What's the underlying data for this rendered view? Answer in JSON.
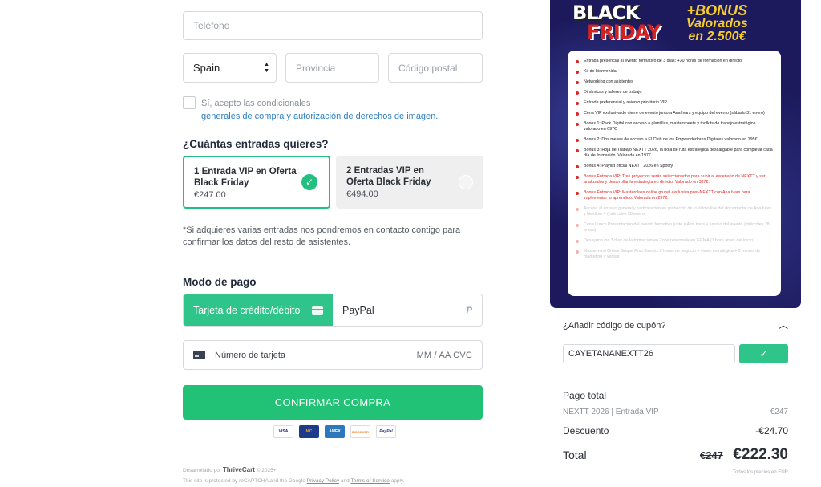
{
  "form": {
    "phone_placeholder": "Teléfono",
    "country_value": "Spain",
    "province_placeholder": "Provincia",
    "postal_placeholder": "Código postal",
    "terms_text": "Sí, acepto las condicionales",
    "terms_link": "generales de compra y autorización de derechos de imagen."
  },
  "tickets": {
    "heading": "¿Cuántas entradas quieres?",
    "options": [
      {
        "name": "1 Entrada VIP en Oferta Black Friday",
        "price": "€247.00",
        "selected": true
      },
      {
        "name": "2 Entradas VIP en Oferta Black Friday",
        "price": "€494.00",
        "selected": false
      }
    ],
    "note": "*Si adquieres varias entradas nos pondremos en contacto contigo para confirmar los datos del resto de asistentes."
  },
  "payment": {
    "heading": "Modo de pago",
    "tab_card": "Tarjeta de crédito/débito",
    "tab_paypal": "PayPal",
    "card_placeholder": "Número de tarjeta",
    "card_right": "MM / AA  CVC",
    "confirm_label": "CONFIRMAR COMPRA",
    "logos": [
      "VISA",
      "MC",
      "AMEX",
      "DISCOVER",
      "PayPal"
    ]
  },
  "footer": {
    "line1_prefix": "Desarrollado por",
    "line1_brand": "ThriveCart",
    "line1_suffix": "© 2025+",
    "line2_prefix": "This site is protected by reCAPTCHA and the Google",
    "privacy": "Privacy Policy",
    "and": "and",
    "terms": "Terms of Service",
    "apply": "apply."
  },
  "promo": {
    "title_line1": "BLACK",
    "title_line2": "FRIDAY",
    "bonus_line1": "+BONUS",
    "bonus_line2": "Valorados",
    "bonus_line3": "en 2.500€",
    "items": [
      "Entrada presencial al evento formativo de 3 días: +30 horas de formación en directo",
      "Kit de bienvenida",
      "Networking con asistentes",
      "Dinámicas y talleres de trabajo",
      "Entrada preferencial y asiento prioritario VIP",
      "Cena VIP exclusiva de cierre de evento junto a Ana Ivars y equipo del evento (sábado 31 enero)",
      "Bonus 1: Pack Digital con acceso a plantillas, mastersheets y toolkits de trabajo estratégico valorado en 697€.",
      "Bonus 2: Dos meses de acceso a El Club de los Emprendedores Digitales valorado en 195€.",
      "Bonus 3: Hoja de Trabajo NEXTT 2026, la hoja de ruta estratégica descargable para completar cada día de formación. Valorada en 197€.",
      "Bonus 4: Playlist oficial NEXTT 2026 en Spotify.",
      "Bonus Entrada VIP: Tres proyectos serán seleccionados para subir al escenario de NEXTT y ser analizados y desarrollar la estrategia en directo. Valorado en 397€.",
      "Bonus Entrada VIP: Masterclass online grupal exclusiva post-NEXTT con Ana Ivars para implementar lo aprendido. Valorada en 297€.",
      "Acceso al ensayo general y participación en grabación de lo último live del documental de Ana Ivars y Nextlow + (miércoles 28 enero)",
      "Cena Lunch Presentación del evento formativo junto a Ana Ivars y equipo del evento (miércoles 28 enero)",
      "Desayuno los 3 días de la formación en Zona reservada en IFEMA (1 hora antes del inicio)",
      "Mastermind Online Grupal Post Evento: 2 horas de negocio + visión estratégica + 2 meses de marketing y ventas"
    ]
  },
  "coupon": {
    "toggle_label": "¿Añadir código de cupón?",
    "code": "CAYETANANEXTT26"
  },
  "summary": {
    "title": "Pago total",
    "item_label": "NEXTT 2026 | Entrada VIP",
    "item_price": "€247",
    "discount_label": "Descuento",
    "discount_value": "-€24.70",
    "total_label": "Total",
    "old_total": "€247",
    "new_total": "€222.30",
    "tax_note": "Todos los precios en EUR"
  }
}
